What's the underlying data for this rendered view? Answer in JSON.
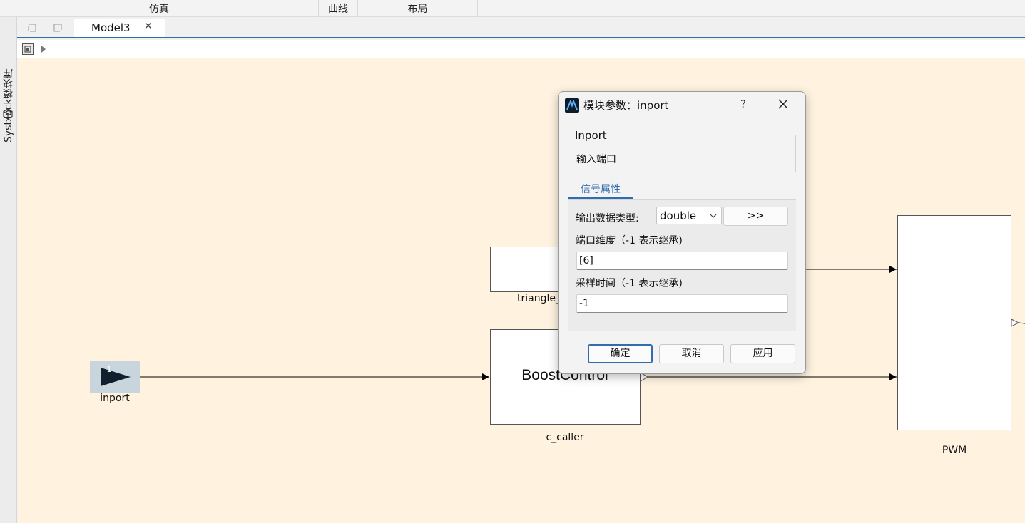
{
  "ribbon": {
    "sections": [
      {
        "label": "仿真"
      },
      {
        "label": "曲线"
      },
      {
        "label": "布局"
      }
    ]
  },
  "sidebar": {
    "label": "Sysblock模块库",
    "icon": "cube-icon"
  },
  "tabs": [
    {
      "label": "Model3",
      "active": true
    }
  ],
  "canvas": {
    "background": "#fff3e0",
    "blocks": {
      "inport": {
        "port_number": "1",
        "label": "inport"
      },
      "triangle": {
        "label": "triangle_"
      },
      "boost": {
        "title": "BoostControl",
        "label": "c_caller"
      },
      "pwm": {
        "label": "PWM"
      }
    }
  },
  "dialog": {
    "title": "模块参数：inport",
    "help": "?",
    "group_title": "Inport",
    "group_desc": "输入端口",
    "tab": "信号属性",
    "fields": {
      "data_type_label": "输出数据类型:",
      "data_type_value": "double",
      "more_button": ">>",
      "dimension_label": "端口维度（-1 表示继承)",
      "dimension_value": "[6]",
      "sample_time_label": "采样时间（-1 表示继承)",
      "sample_time_value": "-1"
    },
    "buttons": {
      "ok": "确定",
      "cancel": "取消",
      "apply": "应用"
    }
  },
  "colors": {
    "accent": "#2f6db3",
    "canvas": "#fff3e0",
    "inport_block": "#c9d5dc",
    "inport_arrow": "#0f1f2e"
  }
}
